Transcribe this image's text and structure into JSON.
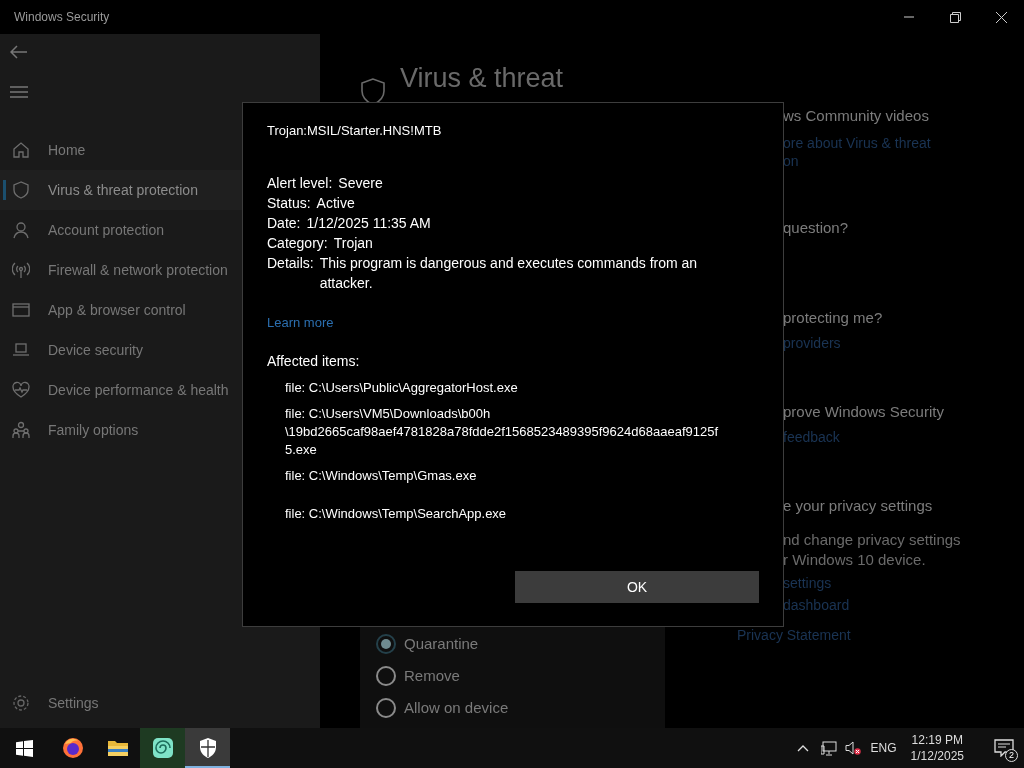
{
  "window": {
    "title": "Windows Security"
  },
  "sidebar": {
    "items": [
      {
        "label": "Home",
        "selected": false
      },
      {
        "label": "Virus & threat protection",
        "selected": true
      },
      {
        "label": "Account protection",
        "selected": false
      },
      {
        "label": "Firewall & network protection",
        "selected": false
      },
      {
        "label": "App & browser control",
        "selected": false
      },
      {
        "label": "Device security",
        "selected": false
      },
      {
        "label": "Device performance & health",
        "selected": false
      },
      {
        "label": "Family options",
        "selected": false
      }
    ],
    "settings": "Settings"
  },
  "main": {
    "heading": "Virus & threat",
    "actions": [
      {
        "label": "Quarantine",
        "selected": true
      },
      {
        "label": "Remove",
        "selected": false
      },
      {
        "label": "Allow on device",
        "selected": false
      }
    ],
    "side_panel": [
      {
        "kind": "heading",
        "text": "ws Community videos"
      },
      {
        "kind": "link",
        "text": "ore about Virus & threat"
      },
      {
        "kind": "link",
        "text": "on"
      },
      {
        "kind": "heading",
        "text": "question?"
      },
      {
        "kind": "heading",
        "text": "protecting me?"
      },
      {
        "kind": "link",
        "text": "providers"
      },
      {
        "kind": "heading",
        "text": "prove Windows Security"
      },
      {
        "kind": "link",
        "text": "feedback"
      },
      {
        "kind": "heading",
        "text": "e your privacy settings"
      },
      {
        "kind": "body",
        "text": "nd change privacy settings"
      },
      {
        "kind": "body",
        "text": "r Windows 10 device."
      },
      {
        "kind": "link",
        "text": "settings"
      },
      {
        "kind": "link",
        "text": "dashboard"
      },
      {
        "kind": "link",
        "text": "Privacy Statement"
      }
    ]
  },
  "dialog": {
    "threat": "Trojan:MSIL/Starter.HNS!MTB",
    "fields": [
      {
        "label": "Alert level:",
        "value": "Severe"
      },
      {
        "label": "Status:",
        "value": "Active"
      },
      {
        "label": "Date:",
        "value": "1/12/2025 11:35 AM"
      },
      {
        "label": "Category:",
        "value": "Trojan"
      },
      {
        "label": "Details:",
        "value": "This program is dangerous and executes commands from an attacker."
      }
    ],
    "learn_more": "Learn more",
    "affected_heading": "Affected items:",
    "affected_items": [
      "file: C:\\Users\\Public\\AggregatorHost.exe",
      "file: C:\\Users\\VM5\\Downloads\\b00h\n\\19bd2665caf98aef4781828a78fdde2f1568523489395f9624d68aaeaf9125f\n5.exe",
      "file: C:\\Windows\\Temp\\Gmas.exe",
      "file: C:\\Windows\\Temp\\SearchApp.exe"
    ],
    "ok": "OK"
  },
  "taskbar": {
    "apps": [
      {
        "active": false
      },
      {
        "active": false
      },
      {
        "active": false
      },
      {
        "active": true
      }
    ],
    "language": "ENG",
    "time": "12:19 PM",
    "date": "1/12/2025",
    "notifications": "2"
  }
}
